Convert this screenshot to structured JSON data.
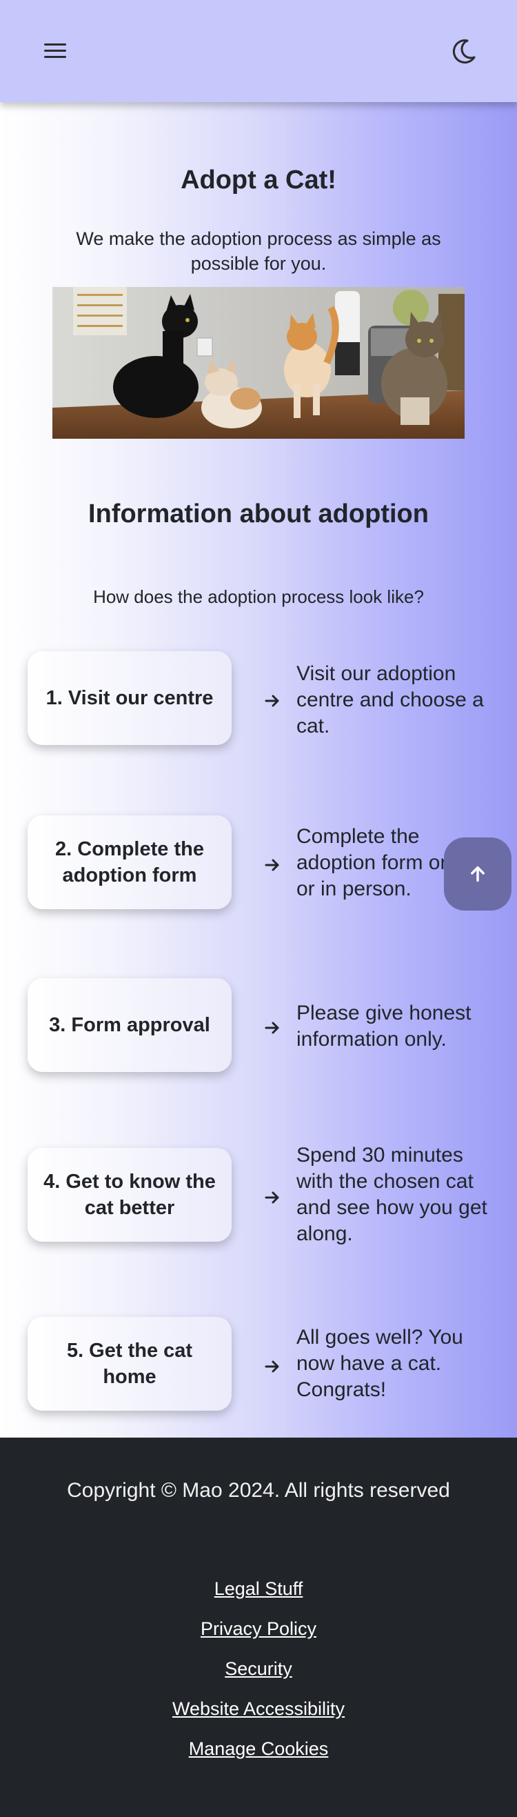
{
  "navbar": {
    "menu_icon": "hamburger-menu-icon",
    "theme_icon": "moon-icon",
    "background": "#c6c7fb"
  },
  "main": {
    "title": "Adopt a Cat!",
    "subtitle": "We make the adoption process as simple as possible for you.",
    "hero_image": "photo of four cats (black, cream, orange, tabby) on a wooden counter",
    "section_title": "Information about adoption",
    "question": "How does the adoption process look like?",
    "steps": [
      {
        "title": "1. Visit our centre",
        "description": "Visit our adoption centre and choose a cat."
      },
      {
        "title": "2. Complete the adoption form",
        "description": "Complete the adoption form online or in person."
      },
      {
        "title": "3. Form approval",
        "description": "Please give honest information only."
      },
      {
        "title": "4. Get to know the cat better",
        "description": "Spend 30 minutes with the chosen cat and see how you get along."
      },
      {
        "title": "5. Get the cat home",
        "description": "All goes well? You now have a cat. Congrats!"
      }
    ],
    "scroll_top_icon": "arrow-up-icon",
    "accent": "#9b9bf6"
  },
  "footer": {
    "copyright": "Copyright © Mao 2024. All rights reserved",
    "links": [
      "Legal Stuff",
      "Privacy Policy",
      "Security",
      "Website Accessibility",
      "Manage Cookies"
    ],
    "background": "#212529"
  }
}
